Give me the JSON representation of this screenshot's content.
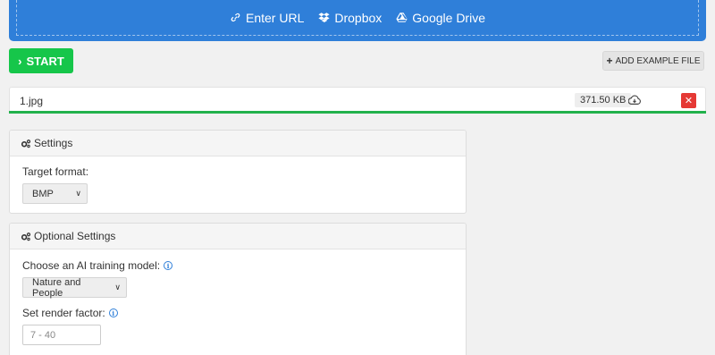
{
  "upload_sources": [
    {
      "label": "Enter URL",
      "icon": "link-icon"
    },
    {
      "label": "Dropbox",
      "icon": "dropbox-icon"
    },
    {
      "label": "Google Drive",
      "icon": "google-drive-icon"
    }
  ],
  "actions": {
    "start_label": "START",
    "add_example_label": "ADD EXAMPLE FILE"
  },
  "file": {
    "name": "1.jpg",
    "size": "371.50 KB",
    "progress": 1.0
  },
  "settings": {
    "title": "Settings",
    "target_format_label": "Target format:",
    "target_format_value": "BMP"
  },
  "optional_settings": {
    "title": "Optional Settings",
    "ai_model_label": "Choose an AI training model:",
    "ai_model_value": "Nature and People",
    "render_factor_label": "Set render factor:",
    "render_factor_placeholder": "7 - 40"
  },
  "colors": {
    "upload_bar": "#2f7fd9",
    "start_button": "#16c64a",
    "progress": "#22b14c",
    "remove_button": "#e53935"
  }
}
